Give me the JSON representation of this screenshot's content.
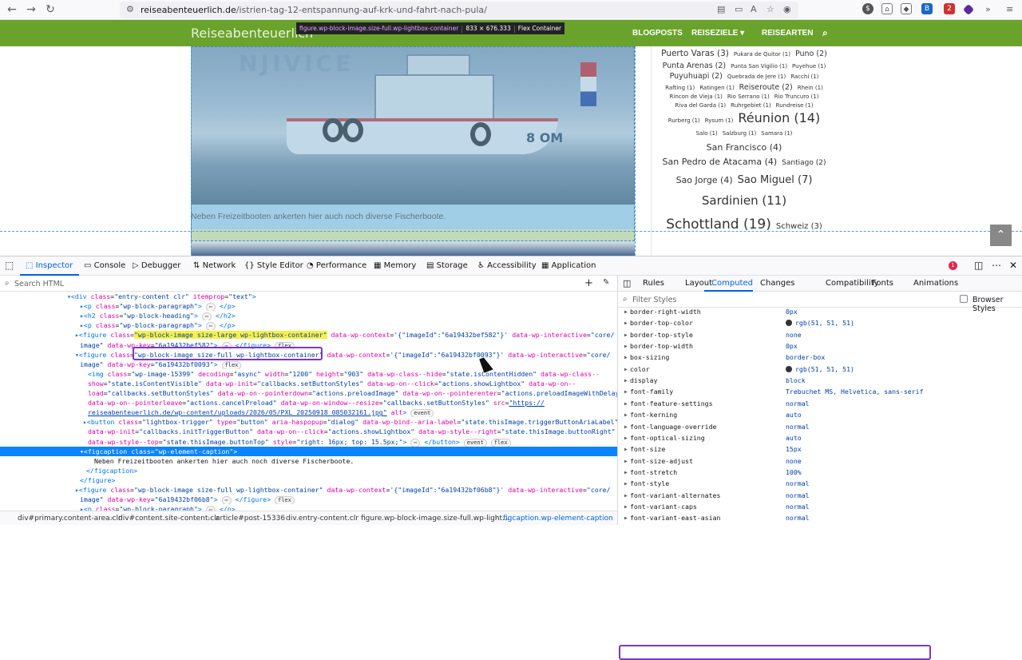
{
  "browser": {
    "url_domain": "reiseabenteuerlich.de",
    "url_path": "/istrien-tag-12-entspannung-auf-krk-und-fahrt-nach-pula/"
  },
  "site": {
    "title": "Reiseabenteuerlich",
    "nav": [
      "BLOGPOSTS",
      "REISEZIELE",
      "REISEARTEN"
    ],
    "nav_chevron": "▾",
    "photo_watermark": "NJIVICE",
    "photo_boat_number": "8 OM",
    "caption": "Neben Freizeitbooten ankerten hier auch noch diverse Fischerboote.",
    "tooltip": {
      "name": "figure.wp-block-image.size-full.wp-lightbox-container",
      "size": "833 × 676.333",
      "type": "Flex Container"
    }
  },
  "tag_cloud": [
    [
      {
        "t": "Puerto Varas (3)",
        "s": 10.5
      },
      {
        "t": "Pukara de Quitor (1)",
        "s": 7
      },
      {
        "t": "Puno (2)",
        "s": 9.5
      }
    ],
    [
      {
        "t": "Punta Arenas (2)",
        "s": 9.5
      },
      {
        "t": "Punta San Vigilio (1)",
        "s": 7
      },
      {
        "t": "Puyehue (1)",
        "s": 7
      }
    ],
    [
      {
        "t": "Puyuhuapi (2)",
        "s": 9.5
      },
      {
        "t": "Quebrada de Jere (1)",
        "s": 7
      },
      {
        "t": "Racchi (1)",
        "s": 7
      }
    ],
    [
      {
        "t": "Rafting (1)",
        "s": 7
      },
      {
        "t": "Ratingen (1)",
        "s": 7
      },
      {
        "t": "Reiseroute (2)",
        "s": 9.5
      },
      {
        "t": "Rhein (1)",
        "s": 7
      }
    ],
    [
      {
        "t": "Rincon de Vieja (1)",
        "s": 7
      },
      {
        "t": "Rio Serrano (1)",
        "s": 7
      },
      {
        "t": "Rio Truncuro (1)",
        "s": 7
      }
    ],
    [
      {
        "t": "Riva del Garda (1)",
        "s": 7
      },
      {
        "t": "Ruhrgebiet (1)",
        "s": 7
      },
      {
        "t": "Rundreise (1)",
        "s": 7
      }
    ],
    [
      {
        "t": "Rurberg (1)",
        "s": 7
      },
      {
        "t": "Rysum (1)",
        "s": 7
      },
      {
        "t": "Réunion (14)",
        "s": 16
      }
    ],
    [
      {
        "t": "Salo (1)",
        "s": 7
      },
      {
        "t": "Salzburg (1)",
        "s": 7
      },
      {
        "t": "Samara (1)",
        "s": 7
      }
    ],
    [
      {
        "t": "San Francisco (4)",
        "s": 11
      }
    ],
    [
      {
        "t": "San Pedro de Atacama (4)",
        "s": 11
      },
      {
        "t": "Santiago (2)",
        "s": 9
      }
    ],
    [
      {
        "t": "Sao Jorge (4)",
        "s": 11
      },
      {
        "t": "Sao Miguel (7)",
        "s": 13
      }
    ],
    [
      {
        "t": "Sardinien (11)",
        "s": 15
      }
    ],
    [
      {
        "t": "Schottland (19)",
        "s": 17
      },
      {
        "t": "Schweiz (3)",
        "s": 10
      }
    ]
  ],
  "devtools": {
    "tabs": [
      "Inspector",
      "Console",
      "Debugger",
      "Network",
      "Style Editor",
      "Performance",
      "Memory",
      "Storage",
      "Accessibility",
      "Application"
    ],
    "error_count": "1",
    "search_placeholder": "Search HTML",
    "markup_lines": [
      {
        "indent": 84,
        "html": "<span class='tg'>▾&lt;div</span> <span class='at'>class</span>=<span class='av'>\"entry-content clr\"</span> <span class='at'>itemprop</span>=<span class='av'>\"text\"</span><span class='tg'>&gt;</span>"
      },
      {
        "indent": 100,
        "html": "<span class='tg'>▸&lt;p</span> <span class='at'>class</span>=<span class='av'>\"wp-block-paragraph\"</span><span class='tg'>&gt;</span> <span class='badge'>⋯</span> <span class='tg'>&lt;/p&gt;</span>"
      },
      {
        "indent": 100,
        "html": "<span class='tg'>▸&lt;h2</span> <span class='at'>class</span>=<span class='av'>\"wp-block-heading\"</span><span class='tg'>&gt;</span> <span class='badge'>⋯</span> <span class='tg'>&lt;/h2&gt;</span>"
      },
      {
        "indent": 100,
        "html": "<span class='tg'>▸&lt;p</span> <span class='at'>class</span>=<span class='av'>\"wp-block-paragraph\"</span><span class='tg'>&gt;</span> <span class='badge'>⋯</span> <span class='tg'>&lt;/p&gt;</span>"
      },
      {
        "indent": 94,
        "html": "<span class='tg'>▸&lt;figure</span> <span class='at'>class</span>=<span class='av hl'>\"wp-block-image size-large wp-lightbox-container\"</span> <span class='at'>data-wp-context</span>=<span class='av'>'{\"imageId\":\"6a19432bef582\"}'</span> <span class='at'>data-wp-interactive</span>=<span class='av'>\"core/</span>"
      },
      {
        "indent": 100,
        "html": "<span class='av'>image\"</span> <span class='at'>data-wp-key</span>=<span class='av'>\"6a19432bef582\"</span><span class='tg'>&gt;</span> <span class='badge'>⋯</span> <span class='tg'>&lt;/figure&gt;</span> <span class='badge'>flex</span>"
      },
      {
        "indent": 94,
        "html": "<span class='tg'>▾&lt;figure</span> <span class='at'>class</span>=<span class='av'>\"wp-block-image size-full wp-lightbox-container\"</span> <span class='at'>data-wp-context</span>=<span class='av'>'{\"imageId\":\"6a19432bf0093\"}'</span> <span class='at'>data-wp-interactive</span>=<span class='av'>\"core/</span>"
      },
      {
        "indent": 100,
        "html": "<span class='av'>image\"</span> <span class='at'>data-wp-key</span>=<span class='av'>\"6a19432bf0093\"</span><span class='tg'>&gt;</span> <span class='badge'>flex</span>"
      },
      {
        "indent": 110,
        "html": "<span class='tg'>&lt;img</span> <span class='at'>class</span>=<span class='av'>\"wp-image-15399\"</span> <span class='at'>decoding</span>=<span class='av'>\"async\"</span> <span class='at'>width</span>=<span class='av'>\"1200\"</span> <span class='at'>height</span>=<span class='av'>\"903\"</span> <span class='at'>data-wp-class--hide</span>=<span class='av'>\"state.isContentHidden\"</span> <span class='at'>data-wp-class--</span>"
      },
      {
        "indent": 110,
        "html": "<span class='at'>show</span>=<span class='av'>\"state.isContentVisible\"</span> <span class='at'>data-wp-init</span>=<span class='av'>\"callbacks.setButtonStyles\"</span> <span class='at'>data-wp-on--click</span>=<span class='av'>\"actions.showLightbox\"</span> <span class='at'>data-wp-on--</span>"
      },
      {
        "indent": 110,
        "html": "<span class='at'>load</span>=<span class='av'>\"callbacks.setButtonStyles\"</span> <span class='at'>data-wp-on--pointerdown</span>=<span class='av'>\"actions.preloadImage\"</span> <span class='at'>data-wp-on--pointerenter</span>=<span class='av'>\"actions.preloadImageWithDelay\"</span>"
      },
      {
        "indent": 110,
        "html": "<span class='at'>data-wp-on--pointerleave</span>=<span class='av'>\"actions.cancelPreload\"</span> <span class='at'>data-wp-on-window--resize</span>=<span class='av'>\"callbacks.setButtonStyles\"</span> <span class='at'>src</span>=<span class='av'><u>\"https://</u></span>"
      },
      {
        "indent": 110,
        "html": "<span class='av'><u>reiseabenteuerlich.de/wp-content/uploads/2026/05/PXL_20250918_085032161.jpg\"</u></span> <span class='at'>alt</span><span class='tg'>&gt;</span> <span class='badge'>event</span>"
      },
      {
        "indent": 104,
        "html": "<span class='tg'>▸&lt;button</span> <span class='at'>class</span>=<span class='av'>\"lightbox-trigger\"</span> <span class='at'>type</span>=<span class='av'>\"button\"</span> <span class='at'>aria-haspopup</span>=<span class='av'>\"dialog\"</span> <span class='at'>data-wp-bind--aria-label</span>=<span class='av'>\"state.thisImage.triggerButtonAriaLabel\"</span>"
      },
      {
        "indent": 110,
        "html": "<span class='at'>data-wp-init</span>=<span class='av'>\"callbacks.initTriggerButton\"</span> <span class='at'>data-wp-on--click</span>=<span class='av'>\"actions.showLightbox\"</span> <span class='at'>data-wp-style--right</span>=<span class='av'>\"state.thisImage.buttonRight\"</span>"
      },
      {
        "indent": 110,
        "html": "<span class='at'>data-wp-style--top</span>=<span class='av'>\"state.thisImage.buttonTop\"</span> <span class='at'>style</span>=<span class='av'>\"right: 16px; top: 15.5px;\"</span><span class='tg'>&gt;</span> <span class='badge'>⋯</span> <span class='tg'>&lt;/button&gt;</span> <span class='badge'>event</span> <span class='badge'>flex</span>"
      },
      {
        "indent": 100,
        "html": "<span class='tg'>▾&lt;figcaption</span> <span class='at'>class</span>=<span class='av'>\"wp-element-caption\"</span><span class='tg'>&gt;</span>",
        "selected": true
      },
      {
        "indent": 118,
        "html": "Neben Freizeitbooten ankerten hier auch noch diverse Fischerboote."
      },
      {
        "indent": 108,
        "html": "<span class='tg'>&lt;/figcaption&gt;</span>"
      },
      {
        "indent": 100,
        "html": "<span class='tg'>&lt;/figure&gt;</span>"
      },
      {
        "indent": 94,
        "html": "<span class='tg'>▸&lt;figure</span> <span class='at'>class</span>=<span class='av'>\"wp-block-image size-full wp-lightbox-container\"</span> <span class='at'>data-wp-context</span>=<span class='av'>'{\"imageId\":\"6a19432bf06b8\"}'</span> <span class='at'>data-wp-interactive</span>=<span class='av'>\"core/</span>"
      },
      {
        "indent": 100,
        "html": "<span class='av'>image\"</span> <span class='at'>data-wp-key</span>=<span class='av'>\"6a19432bf06b8\"</span><span class='tg'>&gt;</span> <span class='badge'>⋯</span> <span class='tg'>&lt;/figure&gt;</span> <span class='badge'>flex</span>"
      },
      {
        "indent": 100,
        "html": "<span class='tg'>▸&lt;p</span> <span class='at'>class</span>=<span class='av'>\"wp-block-paragraph\"</span><span class='tg'>&gt;</span> <span class='badge'>⋯</span> <span class='tg'>&lt;/p&gt;</span>"
      }
    ],
    "breadcrumbs": [
      "div#primary.content-area.clr",
      "div#content.site-content.clr",
      "article#post-15336",
      "div.entry-content.clr",
      "figure.wp-block-image.size-full.wp-light...",
      "figcaption.wp-element-caption"
    ],
    "side_tabs": [
      "Rules",
      "Layout",
      "Computed",
      "Changes",
      "Compatibility",
      "Fonts",
      "Animations"
    ],
    "filter_placeholder": "Filter Styles",
    "browser_styles_label": "Browser Styles",
    "computed": [
      {
        "name": "border-right-width",
        "value": "0px"
      },
      {
        "name": "border-top-color",
        "value": "rgb(51, 51, 51)",
        "swatch": true
      },
      {
        "name": "border-top-style",
        "value": "none"
      },
      {
        "name": "border-top-width",
        "value": "0px"
      },
      {
        "name": "box-sizing",
        "value": "border-box"
      },
      {
        "name": "color",
        "value": "rgb(51, 51, 51)",
        "swatch": true
      },
      {
        "name": "display",
        "value": "block"
      },
      {
        "name": "font-family",
        "value": "Trebuchet MS, Helvetica, sans-serif"
      },
      {
        "name": "font-feature-settings",
        "value": "normal"
      },
      {
        "name": "font-kerning",
        "value": "auto"
      },
      {
        "name": "font-language-override",
        "value": "normal"
      },
      {
        "name": "font-optical-sizing",
        "value": "auto"
      },
      {
        "name": "font-size",
        "value": "15px"
      },
      {
        "name": "font-size-adjust",
        "value": "none"
      },
      {
        "name": "font-stretch",
        "value": "100%"
      },
      {
        "name": "font-style",
        "value": "normal"
      },
      {
        "name": "font-variant-alternates",
        "value": "normal"
      },
      {
        "name": "font-variant-caps",
        "value": "normal"
      },
      {
        "name": "font-variant-east-asian",
        "value": "normal"
      }
    ]
  }
}
